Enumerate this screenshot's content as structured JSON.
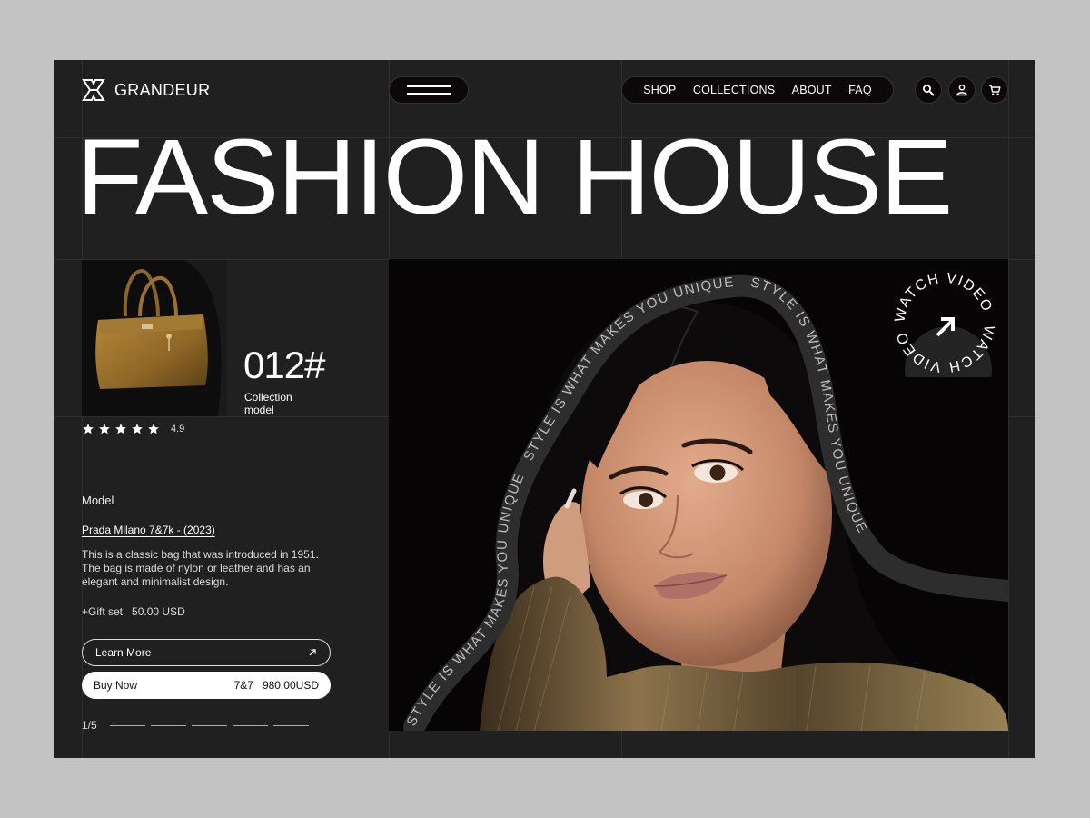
{
  "brand": {
    "name": "GRANDEUR"
  },
  "nav": {
    "items": [
      "SHOP",
      "COLLECTIONS",
      "ABOUT",
      "FAQ"
    ]
  },
  "icons": {
    "search": "search-icon",
    "account": "user-icon",
    "cart": "cart-icon",
    "menu": "hamburger-menu-icon"
  },
  "hero": {
    "title": "FASHION HOUSE"
  },
  "product": {
    "collection_number": "012#",
    "collection_label": "Collection model",
    "rating": "4.9",
    "stars": 5,
    "model_label": "Model",
    "model_name": "Prada Milano 7&7k - (2023)",
    "description": "This is a classic bag that was introduced in 1951. The bag is made of nylon or leather and has an elegant and minimalist design.",
    "gift_label": "+Gift set",
    "gift_price": "50.00 USD",
    "learn_more_label": "Learn More",
    "buy_now_label": "Buy Now",
    "buy_code": "7&7",
    "price": "980.00USD"
  },
  "pager": {
    "current": "1/5",
    "total_pages": 5
  },
  "photo": {
    "ribbon_text": "STYLE IS WHAT MAKES YOU UNIQUE",
    "watch_video_text": "WATCH VIDEO"
  },
  "colors": {
    "background": "#202020",
    "page": "#c3c3c3",
    "pill": "#0c0709",
    "accent": "#ffffff",
    "gold": "#a0782e"
  }
}
